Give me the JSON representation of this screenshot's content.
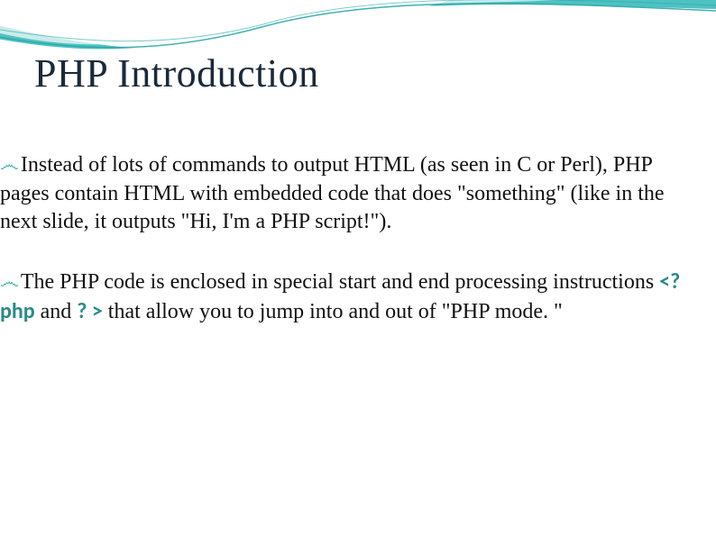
{
  "title": "PHP Introduction",
  "bullet_glyph": "෴",
  "paragraphs": [
    {
      "pre": "Instead of lots of commands to output HTML (as seen in C or Perl), PHP pages contain HTML with embedded code that does \"something\" (like in the next slide, it outputs \"Hi, I'm a PHP script!\").",
      "tag1": "",
      "mid": "",
      "tag2": "",
      "post": ""
    },
    {
      "pre": "The PHP code is enclosed in special start and end processing instructions ",
      "tag1": "<? php",
      "mid": " and ",
      "tag2": "? >",
      "post": "  that allow you to jump into and out of \"PHP mode. \""
    }
  ]
}
